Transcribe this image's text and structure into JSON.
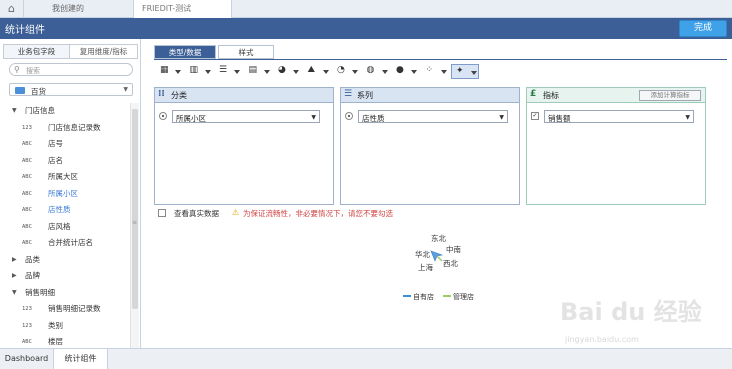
{
  "top_tabs": {
    "home_icon": "home-icon",
    "mine": "我创建的",
    "active": "FRIEDIT-测试"
  },
  "title_bar": {
    "title": "统计组件",
    "done": "完成"
  },
  "left_panel": {
    "tabs": [
      "业务包字段",
      "复用维度/指标"
    ],
    "search_placeholder": "搜索",
    "package": "百货",
    "tree": [
      {
        "kind": "group",
        "label": "门店信息",
        "expanded": true
      },
      {
        "kind": "field",
        "type": "123",
        "label": "门店信息记录数"
      },
      {
        "kind": "field",
        "type": "ABC",
        "label": "店号"
      },
      {
        "kind": "field",
        "type": "ABC",
        "label": "店名"
      },
      {
        "kind": "field",
        "type": "ABC",
        "label": "所属大区"
      },
      {
        "kind": "field",
        "type": "ABC",
        "label": "所属小区",
        "selected": true
      },
      {
        "kind": "field",
        "type": "ABC",
        "label": "店性质",
        "selected": true
      },
      {
        "kind": "field",
        "type": "ABC",
        "label": "店风格"
      },
      {
        "kind": "field",
        "type": "ABC",
        "label": "合并统计店名"
      },
      {
        "kind": "group",
        "label": "品类",
        "expanded": false
      },
      {
        "kind": "group",
        "label": "品牌",
        "expanded": false
      },
      {
        "kind": "group",
        "label": "销售明细",
        "expanded": true
      },
      {
        "kind": "field",
        "type": "123",
        "label": "销售明细记录数"
      },
      {
        "kind": "field",
        "type": "123",
        "label": "类别"
      },
      {
        "kind": "field",
        "type": "ABC",
        "label": "楼层"
      }
    ]
  },
  "right_tabs": [
    "类型/数据",
    "样式"
  ],
  "chart_type_icons": [
    "table-icon",
    "bar-chart-icon",
    "horizontal-bar-icon",
    "stacked-bar-icon",
    "pie-chart-icon",
    "map-icon",
    "gauge-icon",
    "ring-icon",
    "bubble-icon",
    "scatter-icon",
    "radar-icon"
  ],
  "panes": {
    "category": {
      "icon": "category-icon",
      "title": "分类",
      "field": "所属小区"
    },
    "series": {
      "icon": "series-icon",
      "title": "系列",
      "field": "店性质"
    },
    "metric": {
      "icon": "metric-icon",
      "title": "指标",
      "add_button": "添加计算指标",
      "field": "销售额"
    }
  },
  "real_data": {
    "label": "查看真实数据",
    "warning": "为保证流畅性，非必要情况下，请您不要勾选"
  },
  "preview": {
    "labels": [
      "东北",
      "华北",
      "中南",
      "上海",
      "西北"
    ],
    "legend": [
      {
        "name": "自有店",
        "color": "#3a8fd6"
      },
      {
        "name": "管理店",
        "color": "#9ccc65"
      }
    ]
  },
  "watermark": {
    "logo": "Bai du 经验",
    "url": "jingyan.baidu.com"
  },
  "bottom_tabs": [
    "Dashboard",
    "统计组件"
  ]
}
